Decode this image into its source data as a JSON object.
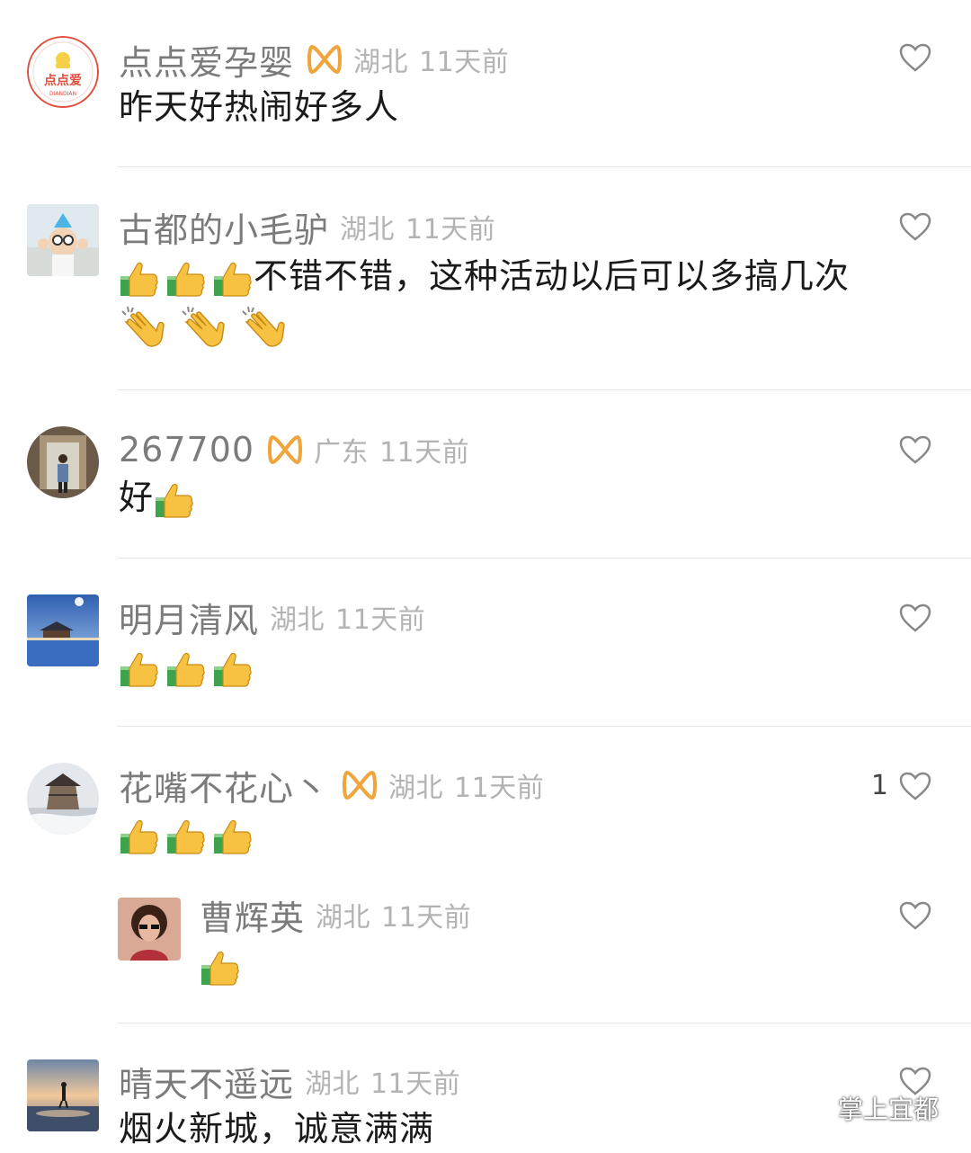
{
  "comments": [
    {
      "name": "点点爱孕婴",
      "region": "湖北",
      "time": "11天前",
      "badge": true,
      "text": "昨天好热闹好多人",
      "thumbs": 0,
      "claps": 0,
      "likes": ""
    },
    {
      "name": "古都的小毛驴",
      "region": "湖北",
      "time": "11天前",
      "badge": false,
      "text": "不错不错，这种活动以后可以多搞几次",
      "thumbs": 3,
      "claps": 3,
      "likes": ""
    },
    {
      "name": "267700",
      "region": "广东",
      "time": "11天前",
      "badge": true,
      "text": "好",
      "thumbs": 1,
      "claps": 0,
      "likes": ""
    },
    {
      "name": "明月清风",
      "region": "湖北",
      "time": "11天前",
      "badge": false,
      "text": "",
      "thumbs": 3,
      "claps": 0,
      "likes": ""
    },
    {
      "name": "花嘴不花心丶",
      "region": "湖北",
      "time": "11天前",
      "badge": true,
      "text": "",
      "thumbs": 3,
      "claps": 0,
      "likes": "1"
    },
    {
      "name": "曹辉英",
      "region": "湖北",
      "time": "11天前",
      "badge": false,
      "text": "",
      "thumbs": 1,
      "claps": 0,
      "likes": "",
      "reply": true
    },
    {
      "name": "晴天不遥远",
      "region": "湖北",
      "time": "11天前",
      "badge": false,
      "text": "烟火新城，诚意满满",
      "thumbs": 0,
      "claps": 0,
      "likes": ""
    }
  ],
  "watermark": "掌上宜都",
  "icons": {
    "like": "heart-outline-icon",
    "badge": "infinity-badge-icon",
    "thumb": "thumbs-up-emoji",
    "clap": "clapping-hands-emoji",
    "wechat": "wechat-icon"
  },
  "colors": {
    "name": "#7b7b7b",
    "meta": "#b3b3b3",
    "text": "#1a1a1a",
    "badge": "#f0a43c"
  }
}
